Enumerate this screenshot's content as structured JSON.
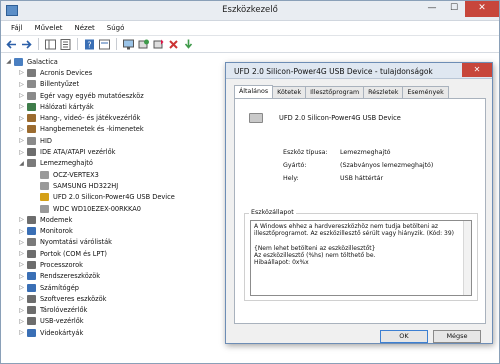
{
  "window": {
    "title": "Eszközkezelő"
  },
  "menu": [
    "Fájl",
    "Művelet",
    "Nézet",
    "Súgó"
  ],
  "tree": [
    {
      "label": "Galactica",
      "level": 0,
      "expand": "◢",
      "color": "#4a7fc1"
    },
    {
      "label": "Acronis Devices",
      "level": 1,
      "expand": "▷",
      "color": "#7a7a7a"
    },
    {
      "label": "Billentyűzet",
      "level": 1,
      "expand": "▷",
      "color": "#8a8a8a"
    },
    {
      "label": "Egér vagy egyéb mutatóeszköz",
      "level": 1,
      "expand": "▷",
      "color": "#8a8a8a"
    },
    {
      "label": "Hálózati kártyák",
      "level": 1,
      "expand": "▷",
      "color": "#3f7d4a"
    },
    {
      "label": "Hang-, videó- és játékvezérlők",
      "level": 1,
      "expand": "▷",
      "color": "#9b6b2f"
    },
    {
      "label": "Hangbemenetek és -kimenetek",
      "level": 1,
      "expand": "▷",
      "color": "#9b6b2f"
    },
    {
      "label": "HID",
      "level": 1,
      "expand": "▷",
      "color": "#8a8a8a"
    },
    {
      "label": "IDE ATA/ATAPI vezérlők",
      "level": 1,
      "expand": "▷",
      "color": "#6d6d6d"
    },
    {
      "label": "Lemezmeghajtó",
      "level": 1,
      "expand": "◢",
      "color": "#7a7a7a"
    },
    {
      "label": "OCZ-VERTEX3",
      "level": 2,
      "expand": "",
      "color": "#9a9a9a"
    },
    {
      "label": "SAMSUNG HD322HJ",
      "level": 2,
      "expand": "",
      "color": "#9a9a9a"
    },
    {
      "label": "UFD 2.0 Silicon-Power4G USB Device",
      "level": 2,
      "expand": "",
      "color": "#d4a017"
    },
    {
      "label": "WDC WD10EZEX-00RKKA0",
      "level": 2,
      "expand": "",
      "color": "#9a9a9a"
    },
    {
      "label": "Modemek",
      "level": 1,
      "expand": "▷",
      "color": "#6d6d6d"
    },
    {
      "label": "Monitorok",
      "level": 1,
      "expand": "▷",
      "color": "#3a6fb5"
    },
    {
      "label": "Nyomtatási várólisták",
      "level": 1,
      "expand": "▷",
      "color": "#7a7a7a"
    },
    {
      "label": "Portok (COM és LPT)",
      "level": 1,
      "expand": "▷",
      "color": "#6d6d6d"
    },
    {
      "label": "Processzorok",
      "level": 1,
      "expand": "▷",
      "color": "#6d6d6d"
    },
    {
      "label": "Rendszereszközök",
      "level": 1,
      "expand": "▷",
      "color": "#3a6fb5"
    },
    {
      "label": "Számítógép",
      "level": 1,
      "expand": "▷",
      "color": "#3a6fb5"
    },
    {
      "label": "Szoftveres eszközök",
      "level": 1,
      "expand": "▷",
      "color": "#6d6d6d"
    },
    {
      "label": "Tárolóvezérlők",
      "level": 1,
      "expand": "▷",
      "color": "#6d6d6d"
    },
    {
      "label": "USB-vezérlők",
      "level": 1,
      "expand": "▷",
      "color": "#6d6d6d"
    },
    {
      "label": "Videokártyák",
      "level": 1,
      "expand": "▷",
      "color": "#3a6fb5"
    }
  ],
  "dialog": {
    "title": "UFD 2.0 Silicon-Power4G USB Device - tulajdonságok",
    "tabs": [
      "Általános",
      "Kötetek",
      "Illesztőprogram",
      "Részletek",
      "Események"
    ],
    "device_name": "UFD 2.0 Silicon-Power4G USB Device",
    "props": [
      {
        "label": "Eszköz típusa:",
        "value": "Lemezmeghajtó"
      },
      {
        "label": "Gyártó:",
        "value": "(Szabványos lemezmeghajtó)"
      },
      {
        "label": "Hely:",
        "value": "USB háttértár"
      }
    ],
    "status_label": "Eszközállapot",
    "status_lines": [
      "A Windows ehhez a hardvereszközhöz nem tudja betölteni az",
      "illesztőprogramot. Az eszközillesztő sérült vagy hiányzik. (Kód: 39)",
      "",
      "{Nem lehet betölteni az eszközillesztőt}",
      "Az eszközillesztő (%hs) nem tölthető be.",
      "Hibaállapot: 0x%x"
    ],
    "ok_label": "OK",
    "cancel_label": "Mégse"
  },
  "colors": {
    "accent": "#3c7fd2",
    "close": "#c7463b"
  }
}
